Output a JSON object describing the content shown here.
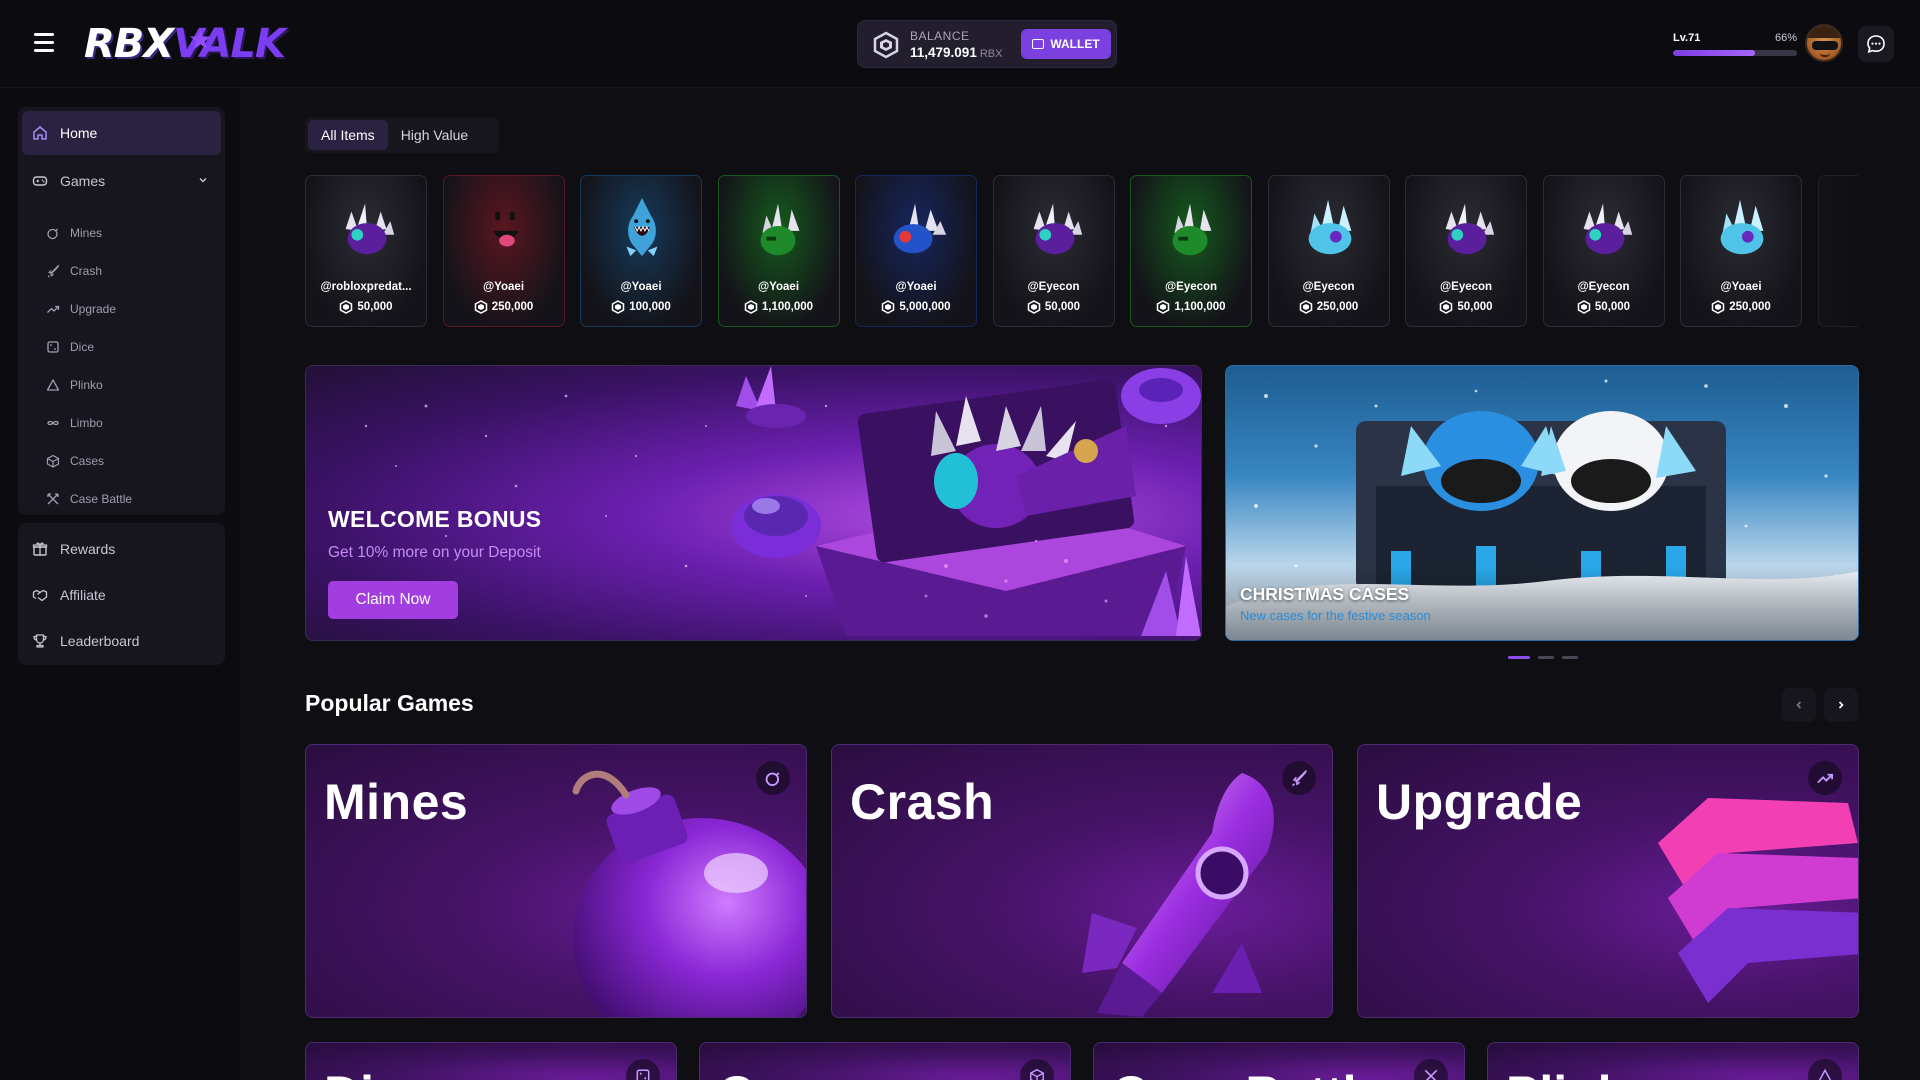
{
  "header": {
    "logo_part1": "RBX",
    "logo_part2": "VALK",
    "balance_label": "BALANCE",
    "balance_value": "11,479.091",
    "balance_unit": "RBX",
    "wallet_label": "WALLET",
    "level_label": "Lv.71",
    "level_percent_label": "66%",
    "level_progress": 0.66
  },
  "sidebar": {
    "home": "Home",
    "games": "Games",
    "sub_items": [
      "Mines",
      "Crash",
      "Upgrade",
      "Dice",
      "Plinko",
      "Limbo",
      "Cases",
      "Case Battle"
    ],
    "rewards": "Rewards",
    "affiliate": "Affiliate",
    "leaderboard": "Leaderboard"
  },
  "filters": {
    "all_items": "All Items",
    "high_value": "High Value"
  },
  "items": [
    {
      "owner": "@robloxpredat...",
      "value": "50,000",
      "glow": "#2b2b33",
      "art": "valk-purple"
    },
    {
      "owner": "@Yoaei",
      "value": "250,000",
      "glow": "#5a1620",
      "art": "face"
    },
    {
      "owner": "@Yoaei",
      "value": "100,000",
      "glow": "#163a5a",
      "art": "shark"
    },
    {
      "owner": "@Yoaei",
      "value": "1,100,000",
      "glow": "#155a1d",
      "art": "valk-green"
    },
    {
      "owner": "@Yoaei",
      "value": "5,000,000",
      "glow": "#16265e",
      "art": "valk-blue"
    },
    {
      "owner": "@Eyecon",
      "value": "50,000",
      "glow": "#2b2b33",
      "art": "valk-purple"
    },
    {
      "owner": "@Eyecon",
      "value": "1,100,000",
      "glow": "#155a1d",
      "art": "valk-green"
    },
    {
      "owner": "@Eyecon",
      "value": "250,000",
      "glow": "#2b2b33",
      "art": "valk-ice"
    },
    {
      "owner": "@Eyecon",
      "value": "50,000",
      "glow": "#2b2b33",
      "art": "valk-purple"
    },
    {
      "owner": "@Eyecon",
      "value": "50,000",
      "glow": "#2b2b33",
      "art": "valk-purple"
    },
    {
      "owner": "@Yoaei",
      "value": "250,000",
      "glow": "#2b2b33",
      "art": "valk-ice"
    }
  ],
  "banners": {
    "welcome_title": "WELCOME BONUS",
    "welcome_subtitle": "Get 10% more on your Deposit",
    "claim_label": "Claim Now",
    "xmas_title": "CHRISTMAS CASES",
    "xmas_subtitle": "New cases for the festive season"
  },
  "popular": {
    "title": "Popular Games",
    "games": [
      {
        "title": "Mines",
        "icon": "bomb-icon"
      },
      {
        "title": "Crash",
        "icon": "rocket-icon"
      },
      {
        "title": "Upgrade",
        "icon": "trend-up-icon"
      }
    ],
    "row2": [
      {
        "title": "Dice",
        "icon": "dice-icon"
      },
      {
        "title": "Cases",
        "icon": "box-icon"
      },
      {
        "title": "Case Battle",
        "icon": "swords-icon"
      },
      {
        "title": "Plinko",
        "icon": "triangle-icon"
      }
    ]
  },
  "colors": {
    "accent": "#7c3fe0",
    "background": "#0f0e13",
    "panel": "#17151e"
  }
}
